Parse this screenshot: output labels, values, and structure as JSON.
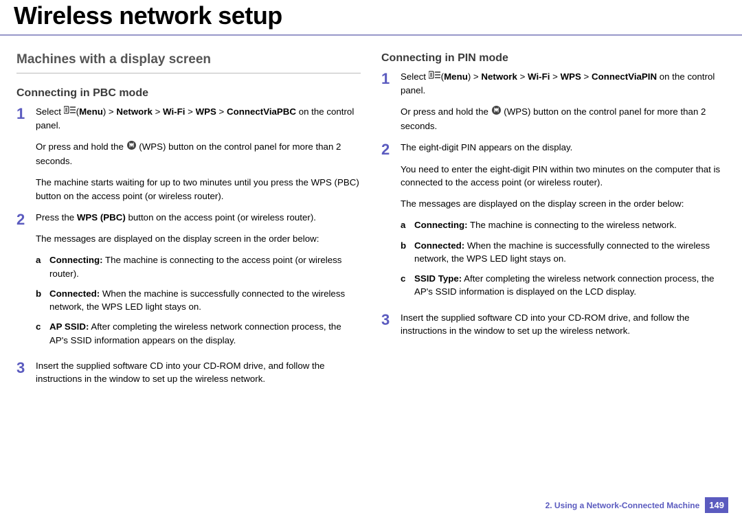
{
  "title": "Wireless network setup",
  "left": {
    "section": "Machines with a display screen",
    "sub": "Connecting in PBC mode",
    "step1_a": "Select ",
    "step1_b_open": "(",
    "step1_b_menu": "Menu",
    "step1_b_sep": ") > ",
    "step1_b_net": "Network",
    "step1_b_gt1": " > ",
    "step1_b_wifi": "Wi-Fi",
    "step1_b_gt2": " > ",
    "step1_b_wps": "WPS",
    "step1_b_gt3": " > ",
    "step1_b_conn": "ConnectViaPBC",
    "step1_c": " on the control panel.",
    "step1_or1": "Or press and hold the ",
    "step1_or2": " (WPS) button on the control panel for more than 2 seconds.",
    "step1_wait": "The machine starts waiting for up to two minutes until you press the WPS (PBC) button on the access point (or wireless router).",
    "step2_a1": "Press the ",
    "step2_a2": "WPS (PBC)",
    "step2_a3": " button on the access point (or wireless router).",
    "step2_b": "The messages are displayed on the display screen in the order below:",
    "step2_sub_a_l": "a",
    "step2_sub_a_h": "Connecting:",
    "step2_sub_a_t": " The machine is connecting to the access point (or wireless router).",
    "step2_sub_b_l": "b",
    "step2_sub_b_h": "Connected:",
    "step2_sub_b_t": " When the machine is successfully connected to the wireless network, the WPS LED light stays on.",
    "step2_sub_c_l": "c",
    "step2_sub_c_h": "AP SSID:",
    "step2_sub_c_t": " After completing the wireless network connection process, the AP's SSID information appears on the display.",
    "step3": "Insert the supplied software CD into your CD-ROM drive, and follow the instructions in the window to set up the wireless network."
  },
  "right": {
    "sub": "Connecting in PIN mode",
    "step1_a": "Select ",
    "step1_b_open": "(",
    "step1_b_menu": "Menu",
    "step1_b_sep": ") > ",
    "step1_b_net": "Network",
    "step1_b_gt1": " > ",
    "step1_b_wifi": "Wi-Fi",
    "step1_b_gt2": " > ",
    "step1_b_wps": "WPS",
    "step1_b_gt3": " > ",
    "step1_b_conn": "ConnectViaPIN",
    "step1_c": " on the control panel.",
    "step1_or1": "Or press and hold the ",
    "step1_or2": " (WPS) button on the control panel for more than 2 seconds.",
    "step2_a": "The eight-digit PIN appears on the display.",
    "step2_b": "You need to enter the eight-digit PIN within two minutes on the computer that is connected to the access point (or wireless router).",
    "step2_c": "The messages are displayed on the display screen in the order below:",
    "step2_sub_a_l": "a",
    "step2_sub_a_h": "Connecting:",
    "step2_sub_a_t": " The machine is connecting to the wireless network.",
    "step2_sub_b_l": "b",
    "step2_sub_b_h": "Connected:",
    "step2_sub_b_t": " When the machine is successfully connected to the wireless network, the WPS LED light stays on.",
    "step2_sub_c_l": "c",
    "step2_sub_c_h": "SSID Type:",
    "step2_sub_c_t": " After completing the wireless network connection process, the AP's SSID information is displayed on the LCD display.",
    "step3": "Insert the supplied software CD into your CD-ROM drive, and follow the instructions in the window to set up the wireless network."
  },
  "footer": {
    "chapter": "2.  Using a Network-Connected Machine",
    "page": "149"
  },
  "nums": {
    "n1": "1",
    "n2": "2",
    "n3": "3"
  }
}
